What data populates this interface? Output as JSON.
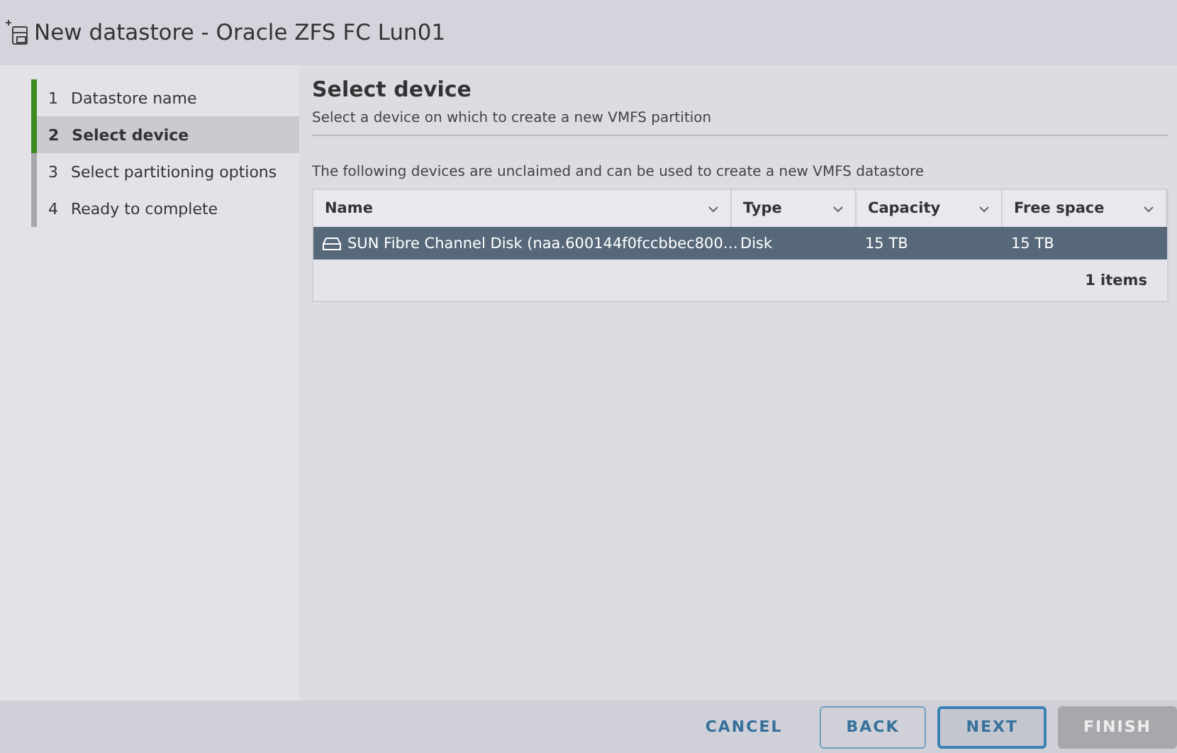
{
  "window": {
    "title": "New datastore - Oracle ZFS FC Lun01"
  },
  "steps": [
    {
      "number": "1",
      "label": "Datastore name",
      "completed": true,
      "selected": false
    },
    {
      "number": "2",
      "label": "Select device",
      "completed": true,
      "selected": true
    },
    {
      "number": "3",
      "label": "Select partitioning options",
      "completed": false,
      "selected": false
    },
    {
      "number": "4",
      "label": "Ready to complete",
      "completed": false,
      "selected": false
    }
  ],
  "page": {
    "heading": "Select device",
    "subtitle": "Select a device on which to create a new VMFS partition",
    "intro": "The following devices are unclaimed and can be used to create a new VMFS datastore"
  },
  "table": {
    "columns": [
      "Name",
      "Type",
      "Capacity",
      "Free space"
    ],
    "rows": [
      {
        "selected": true,
        "cells": [
          "SUN Fibre Channel Disk (naa.600144f0fccbbec800…",
          "Disk",
          "15 TB",
          "15 TB"
        ]
      }
    ],
    "footer": "1 items"
  },
  "buttons": [
    {
      "label": "CANCEL",
      "kind": "flat",
      "disabled": false
    },
    {
      "label": "BACK",
      "kind": "outline",
      "disabled": false
    },
    {
      "label": "NEXT",
      "kind": "primary",
      "disabled": false
    },
    {
      "label": "FINISH",
      "kind": "solid",
      "disabled": true
    }
  ]
}
